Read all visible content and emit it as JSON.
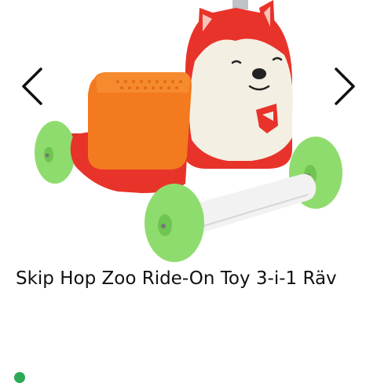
{
  "product": {
    "title": "Skip Hop Zoo Ride-On Toy 3-i-1 Räv",
    "image_alt": "Skip Hop Zoo Ride-On Toy fox",
    "colors": {
      "body": "#e8332a",
      "face": "#f4efe3",
      "seat": "#f47a1f",
      "wheel": "#8fdc6e",
      "axle": "#f2f2f2"
    }
  },
  "carousel": {
    "prev_icon": "chevron-left-icon",
    "next_icon": "chevron-right-icon"
  },
  "availability": {
    "indicator_color": "#2eaa56"
  }
}
